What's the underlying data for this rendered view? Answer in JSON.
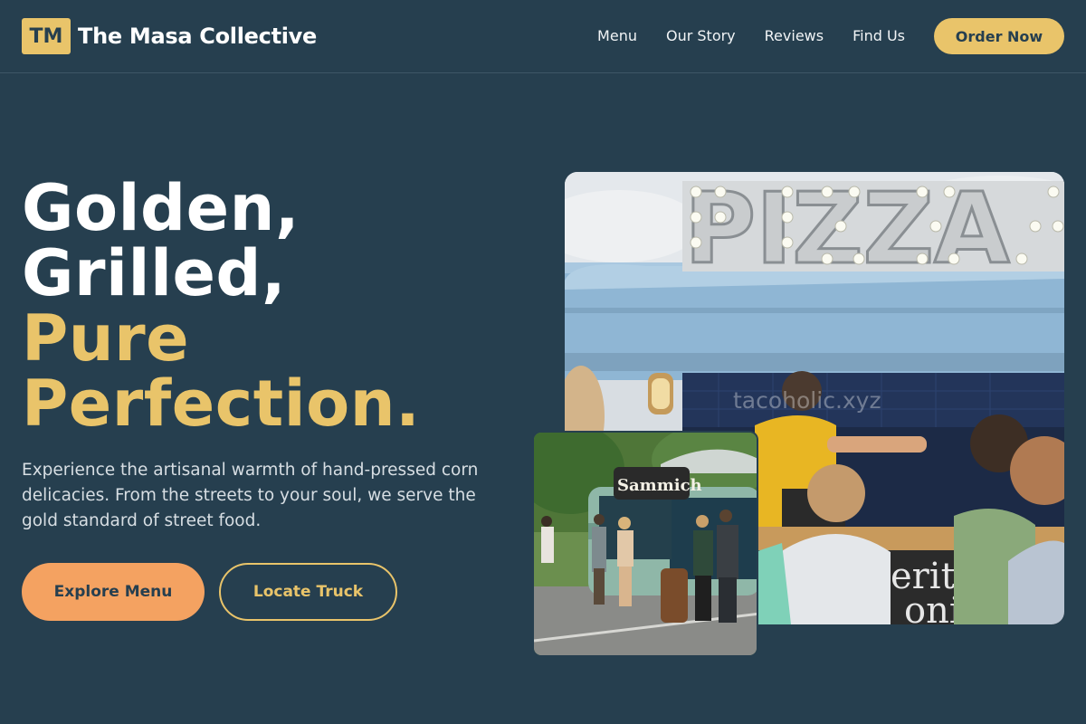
{
  "brand": {
    "mark": "TM",
    "name": "The Masa Collective"
  },
  "nav": {
    "links": [
      "Menu",
      "Our Story",
      "Reviews",
      "Find Us"
    ],
    "cta": "Order Now"
  },
  "hero": {
    "headline_lines": [
      "Golden,",
      "Grilled,",
      "Pure",
      "Perfection."
    ],
    "description": "Experience the artisanal warmth of hand-pressed corn delicacies. From the streets to your soul, we serve the gold standard of street food.",
    "primary_button": "Explore Menu",
    "secondary_button": "Locate Truck"
  },
  "images": {
    "main": {
      "sign_text": "PIZZA",
      "watermark": "tacoholic.xyz",
      "board_text_1": "erit",
      "board_text_2": "oni"
    },
    "secondary": {
      "sign_text": "Sammich"
    }
  },
  "colors": {
    "background": "#263f4f",
    "gold": "#e9c46a",
    "orange": "#f4a261",
    "text": "#ffffff",
    "muted_text": "#d7dee3"
  }
}
